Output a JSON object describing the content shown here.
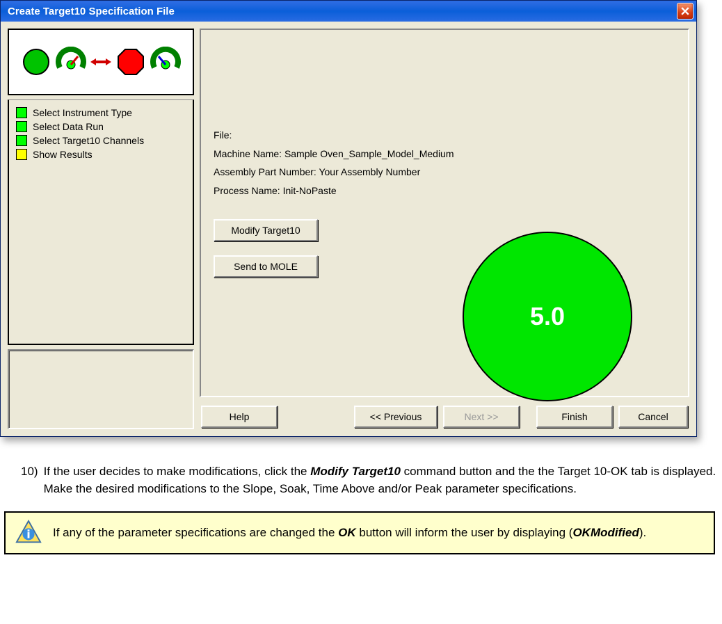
{
  "dialog": {
    "title": "Create Target10 Specification File",
    "sidebar": {
      "items": [
        {
          "color": "green",
          "label": "Select Instrument Type"
        },
        {
          "color": "green",
          "label": "Select Data Run"
        },
        {
          "color": "green",
          "label": "Select Target10 Channels"
        },
        {
          "color": "yellow",
          "label": "Show Results"
        }
      ]
    },
    "info": {
      "file_label": "File:",
      "file_value": "",
      "machine_label": "Machine Name:",
      "machine_value": "Sample Oven_Sample_Model_Medium",
      "assembly_label": "Assembly Part Number:",
      "assembly_value": "Your Assembly Number",
      "process_label": "Process Name:",
      "process_value": "Init-NoPaste"
    },
    "buttons": {
      "modify": "Modify Target10",
      "send": "Send to MOLE"
    },
    "score": "5.0",
    "nav": {
      "help": "Help",
      "previous": "<< Previous",
      "next": "Next >>",
      "finish": "Finish",
      "cancel": "Cancel"
    }
  },
  "doc": {
    "step_number": "10)",
    "step_text_1": "If the user decides to make modifications, click the ",
    "step_bold_1": "Modify Target10",
    "step_text_2": " command button and the the Target 10-OK tab is displayed. Make the desired modifications to the Slope, Soak, Time Above and/or Peak parameter specifications."
  },
  "note": {
    "text_1": "If any of the parameter specifications are changed the ",
    "bold_1": "OK",
    "text_2": " button will inform the user by displaying (",
    "bold_2": "OKModified",
    "text_3": ")."
  }
}
